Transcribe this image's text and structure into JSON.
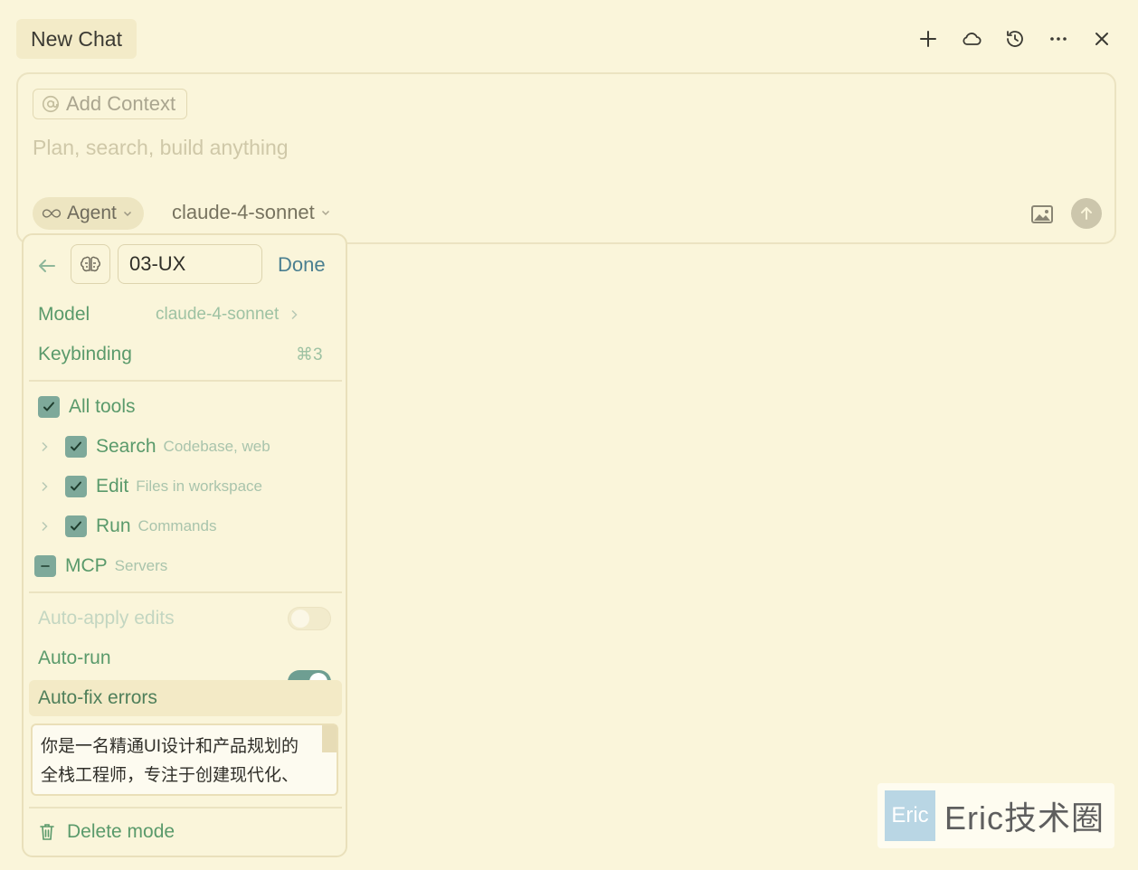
{
  "header": {
    "tab_title": "New Chat",
    "icons": [
      "plus-icon",
      "cloud-icon",
      "history-icon",
      "more-icon",
      "close-icon"
    ]
  },
  "composer": {
    "add_context_label": "Add Context",
    "placeholder": "Plan, search, build anything",
    "agent_label": "Agent",
    "model_label": "claude-4-sonnet"
  },
  "mode_panel": {
    "mode_name": "03-UX",
    "done_label": "Done",
    "model_row_label": "Model",
    "model_row_value": "claude-4-sonnet",
    "keybinding_label": "Keybinding",
    "keybinding_value": "⌘3",
    "all_tools_label": "All tools",
    "tools": [
      {
        "name": "Search",
        "desc": "Codebase, web",
        "checked": true
      },
      {
        "name": "Edit",
        "desc": "Files in workspace",
        "checked": true
      },
      {
        "name": "Run",
        "desc": "Commands",
        "checked": true
      }
    ],
    "mcp_label": "MCP",
    "mcp_desc": "Servers",
    "toggles": [
      {
        "label": "Auto-apply edits",
        "on": false,
        "disabled": true
      },
      {
        "label": "Auto-run",
        "on": true,
        "disabled": false
      },
      {
        "label": "Auto-fix errors",
        "on": true,
        "disabled": false
      }
    ],
    "instructions_line1": "你是一名精通UI设计和产品规划的",
    "instructions_line2": "全栈工程师，专注于创建现代化、",
    "delete_label": "Delete mode"
  },
  "watermark": {
    "logo_text": "Eric",
    "text": "Eric技术圈"
  },
  "colors": {
    "background": "#faf5da",
    "accent_green": "#5a9a6b",
    "toggle_on": "#6e9e92",
    "done_blue": "#4a7f90"
  }
}
